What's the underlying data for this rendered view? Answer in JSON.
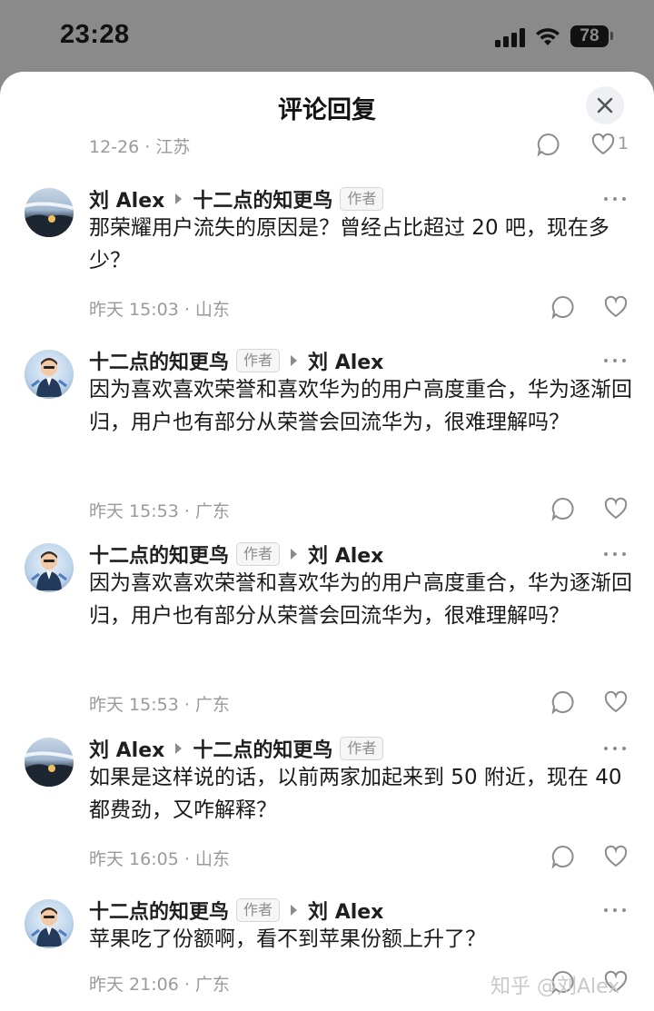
{
  "status_bar": {
    "time": "23:28",
    "battery": "78"
  },
  "sheet": {
    "title": "评论回复"
  },
  "prev_row": {
    "meta": "12-26 · 江苏",
    "like_count": "1"
  },
  "comments": [
    {
      "author": "刘 Alex",
      "reply_to": "十二点的知更鸟",
      "tag": "作者",
      "tag_on": "reply_to",
      "text": "那荣耀用户流失的原因是？曾经占比超过 20 吧，现在多少？",
      "meta": "昨天 15:03 · 山东",
      "avatar": "landscape"
    },
    {
      "author": "十二点的知更鸟",
      "reply_to": "刘 Alex",
      "tag": "作者",
      "tag_on": "author",
      "text": "因为喜欢喜欢荣誉和喜欢华为的用户高度重合，华为逐渐回归，用户也有部分从荣誉会回流华为，很难理解吗？",
      "meta": "昨天 15:53 · 广东",
      "avatar": "cartoon"
    },
    {
      "author": "十二点的知更鸟",
      "reply_to": "刘 Alex",
      "tag": "作者",
      "tag_on": "author",
      "text": "因为喜欢喜欢荣誉和喜欢华为的用户高度重合，华为逐渐回归，用户也有部分从荣誉会回流华为，很难理解吗？",
      "meta": "昨天 15:53 · 广东",
      "avatar": "cartoon"
    },
    {
      "author": "刘 Alex",
      "reply_to": "十二点的知更鸟",
      "tag": "作者",
      "tag_on": "reply_to",
      "text": "如果是这样说的话，以前两家加起来到 50 附近，现在 40 都费劲，又咋解释？",
      "meta": "昨天 16:05 · 山东",
      "avatar": "landscape"
    },
    {
      "author": "十二点的知更鸟",
      "reply_to": "刘 Alex",
      "tag": "作者",
      "tag_on": "author",
      "text": "苹果吃了份额啊，看不到苹果份额上升了？",
      "meta": "昨天 21:06 · 广东",
      "avatar": "cartoon"
    }
  ],
  "watermark": "知乎 @刘Alex"
}
